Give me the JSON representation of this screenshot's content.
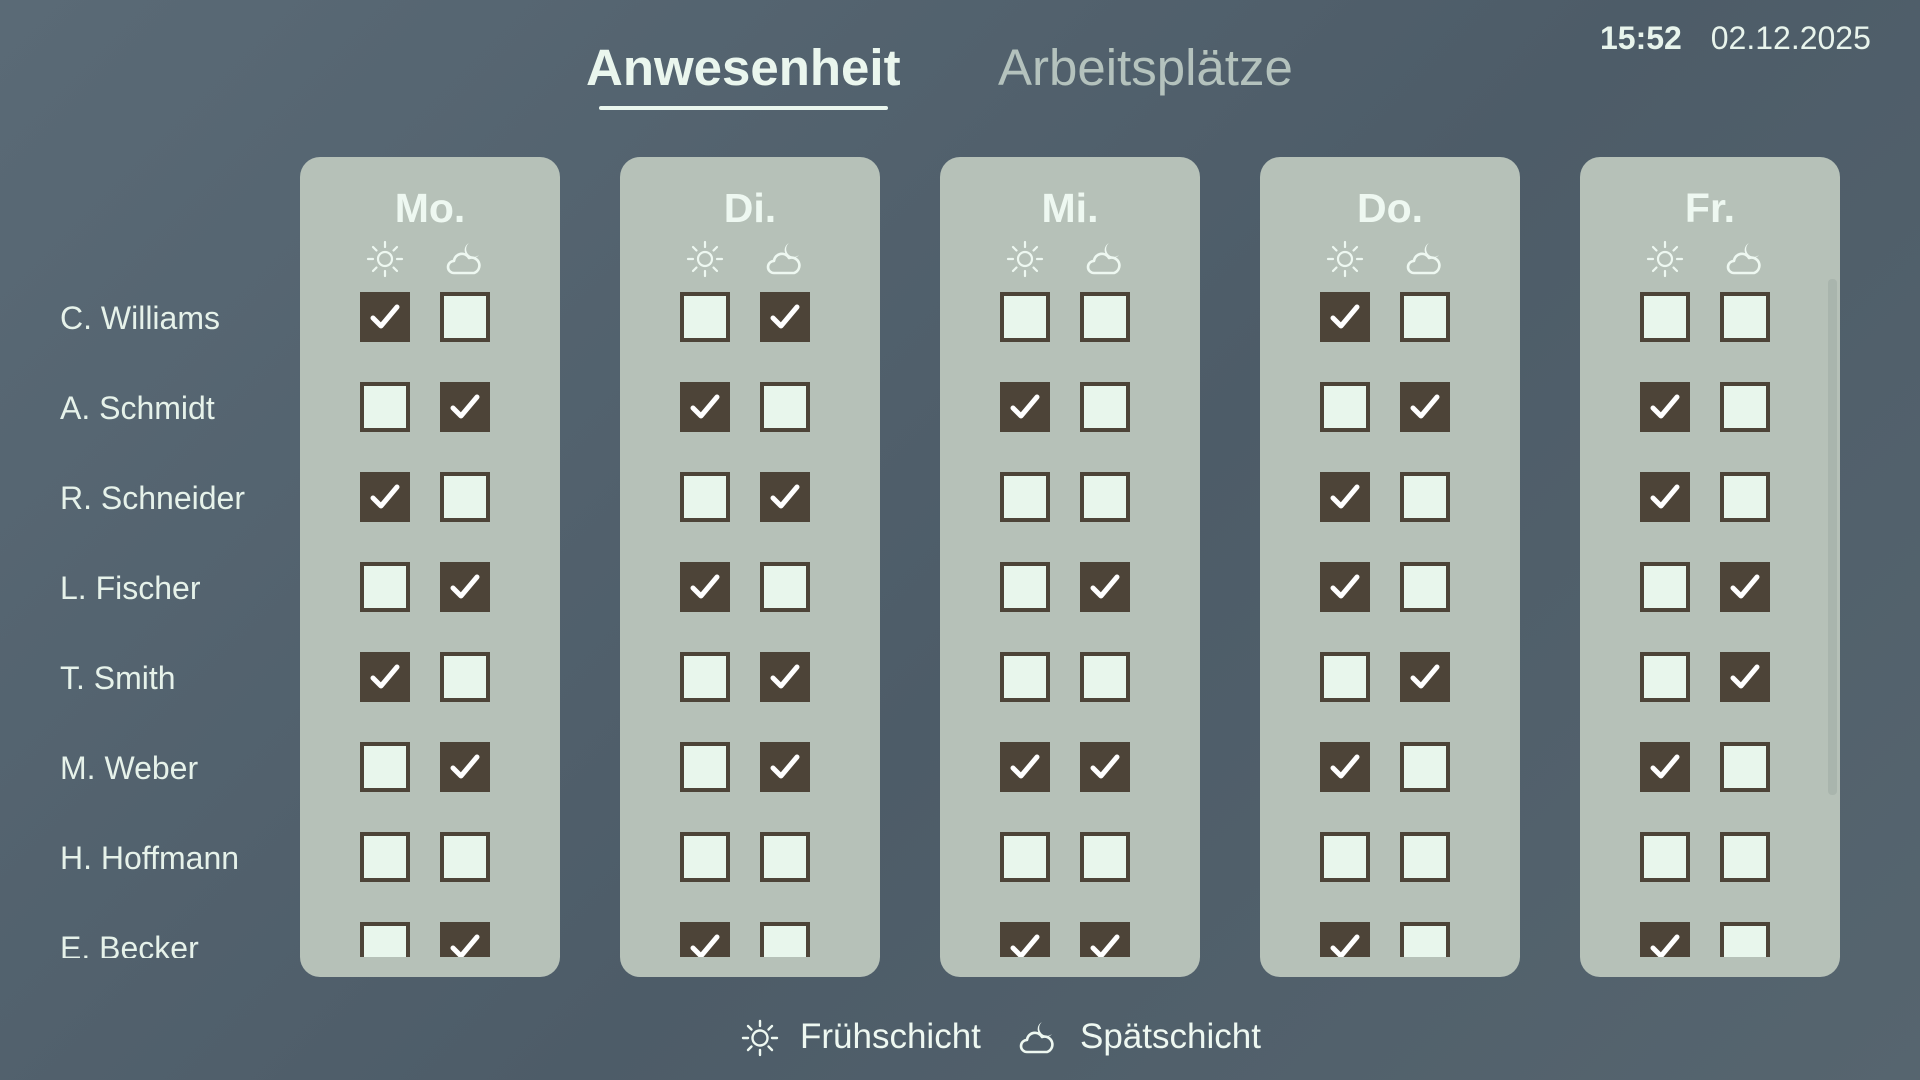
{
  "tabs": {
    "active": "Anwesenheit",
    "inactive": "Arbeitsplätze"
  },
  "clock": {
    "time": "15:52",
    "date": "02.12.2025"
  },
  "shifts": [
    "Frühschicht",
    "Spätschicht"
  ],
  "legend": {
    "early_label": "Frühschicht",
    "late_label": "Spätschicht"
  },
  "icons": {
    "early_shift": "sun-icon",
    "late_shift": "moon-cloud-icon",
    "checked": "checkmark-icon"
  },
  "colors": {
    "background": "#526270",
    "panel": "#b6c1b8",
    "checkbox_fill": "#e8f6ec",
    "checkbox_border": "#4d4438",
    "checkbox_checked": "#4d4438",
    "text": "#e8f4ec"
  },
  "people": [
    "C. Williams",
    "A. Schmidt",
    "R. Schneider",
    "L. Fischer",
    "T. Smith",
    "M. Weber",
    "H. Hoffmann",
    "E. Becker"
  ],
  "days": [
    {
      "label": "Mo.",
      "attendance": [
        [
          1,
          0
        ],
        [
          0,
          1
        ],
        [
          1,
          0
        ],
        [
          0,
          1
        ],
        [
          1,
          0
        ],
        [
          0,
          1
        ],
        [
          0,
          0
        ],
        [
          0,
          1
        ]
      ]
    },
    {
      "label": "Di.",
      "attendance": [
        [
          0,
          1
        ],
        [
          1,
          0
        ],
        [
          0,
          1
        ],
        [
          1,
          0
        ],
        [
          0,
          1
        ],
        [
          0,
          1
        ],
        [
          0,
          0
        ],
        [
          1,
          0
        ]
      ]
    },
    {
      "label": "Mi.",
      "attendance": [
        [
          0,
          0
        ],
        [
          1,
          0
        ],
        [
          0,
          0
        ],
        [
          0,
          1
        ],
        [
          0,
          0
        ],
        [
          1,
          1
        ],
        [
          0,
          0
        ],
        [
          1,
          1
        ]
      ]
    },
    {
      "label": "Do.",
      "attendance": [
        [
          1,
          0
        ],
        [
          0,
          1
        ],
        [
          1,
          0
        ],
        [
          1,
          0
        ],
        [
          0,
          1
        ],
        [
          1,
          0
        ],
        [
          0,
          0
        ],
        [
          1,
          0
        ]
      ]
    },
    {
      "label": "Fr.",
      "attendance": [
        [
          0,
          0
        ],
        [
          1,
          0
        ],
        [
          1,
          0
        ],
        [
          0,
          1
        ],
        [
          0,
          1
        ],
        [
          1,
          0
        ],
        [
          0,
          0
        ],
        [
          1,
          0
        ]
      ]
    }
  ]
}
